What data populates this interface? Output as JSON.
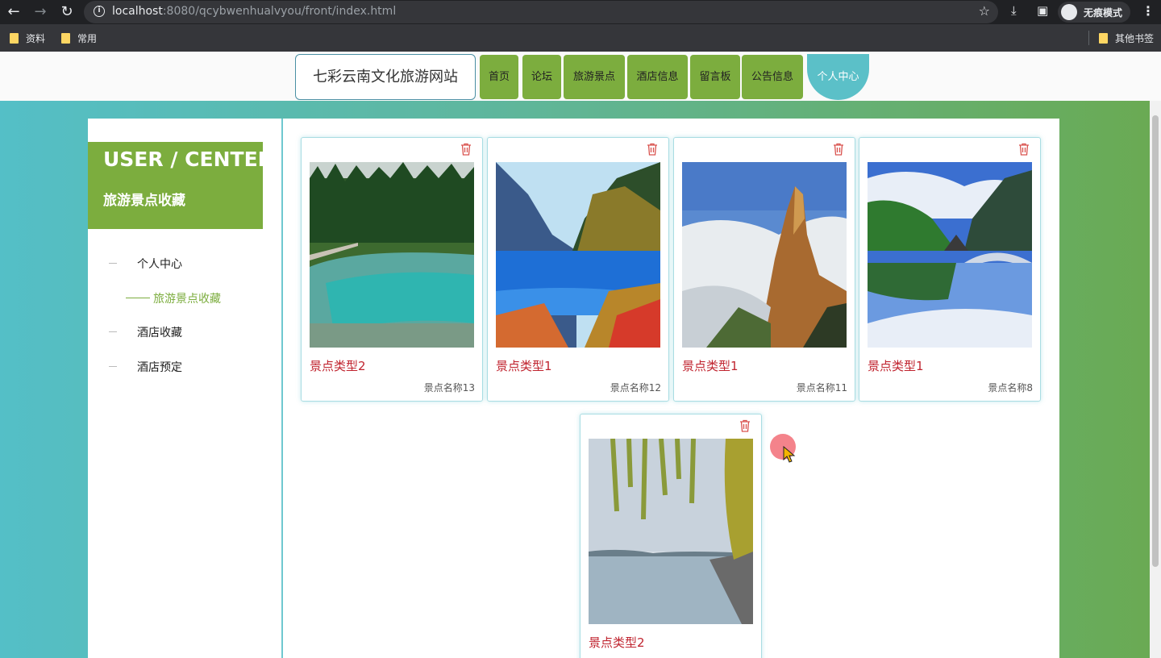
{
  "browser": {
    "url_host": "localhost",
    "url_rest": ":8080/qcybwenhualvyou/front/index.html",
    "incognito_label": "无痕模式",
    "bookmarks": [
      "资料",
      "常用"
    ],
    "other_bookmarks": "其他书签"
  },
  "site": {
    "title": "七彩云南文化旅游网站",
    "nav": [
      "首页",
      "论坛",
      "旅游景点",
      "酒店信息",
      "留言板",
      "公告信息",
      "个人中心"
    ],
    "active_nav": "个人中心"
  },
  "sidebar": {
    "heading_en": "USER / CENTER",
    "heading_cn": "旅游景点收藏",
    "items": [
      "个人中心",
      "旅游景点收藏",
      "酒店收藏",
      "酒店预定"
    ],
    "active_item": "旅游景点收藏"
  },
  "cards": [
    {
      "type": "景点类型2",
      "name": "景点名称13",
      "image": "turquoise-lake-forest"
    },
    {
      "type": "景点类型1",
      "name": "景点名称12",
      "image": "blue-mountain-lake"
    },
    {
      "type": "景点类型1",
      "name": "景点名称11",
      "image": "rock-peak-clouds"
    },
    {
      "type": "景点类型1",
      "name": "景点名称8",
      "image": "snow-mountain-pagoda-bridge"
    },
    {
      "type": "景点类型2",
      "name": "",
      "image": "willow-lakeshore"
    }
  ],
  "colors": {
    "accent_green": "#7cad3e",
    "accent_teal": "#5bc0c8",
    "price_red": "#c0242f"
  },
  "icons": [
    "back-icon",
    "forward-icon",
    "reload-icon",
    "info-icon",
    "star-icon",
    "download-icon",
    "sidepanel-icon",
    "incognito-icon",
    "menu-icon",
    "folder-icon",
    "trash-icon"
  ]
}
